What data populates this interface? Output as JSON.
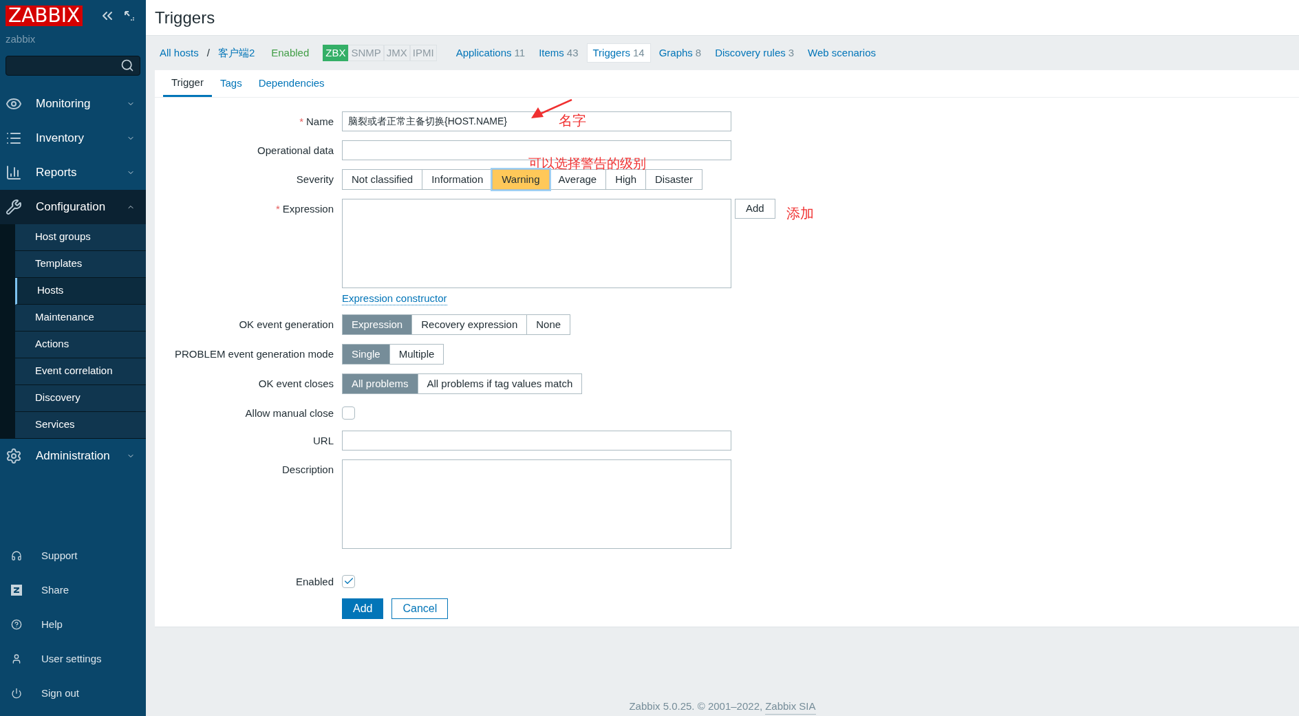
{
  "sidebar": {
    "logo": "ZABBIX",
    "server_name": "zabbix",
    "menu": [
      {
        "label": "Monitoring",
        "expanded": false
      },
      {
        "label": "Inventory",
        "expanded": false
      },
      {
        "label": "Reports",
        "expanded": false
      },
      {
        "label": "Configuration",
        "expanded": true,
        "children": [
          {
            "label": "Host groups",
            "selected": false
          },
          {
            "label": "Templates",
            "selected": false
          },
          {
            "label": "Hosts",
            "selected": true
          },
          {
            "label": "Maintenance",
            "selected": false
          },
          {
            "label": "Actions",
            "selected": false
          },
          {
            "label": "Event correlation",
            "selected": false
          },
          {
            "label": "Discovery",
            "selected": false
          },
          {
            "label": "Services",
            "selected": false
          }
        ]
      },
      {
        "label": "Administration",
        "expanded": false
      }
    ],
    "bottom_menu": [
      "Support",
      "Share",
      "Help",
      "User settings",
      "Sign out"
    ]
  },
  "page_title": "Triggers",
  "breadcrumbs": {
    "items": [
      "All hosts",
      "客户端2"
    ],
    "separator": "/"
  },
  "host_status": "Enabled",
  "availability": [
    {
      "label": "ZBX",
      "on": true
    },
    {
      "label": "SNMP",
      "on": false
    },
    {
      "label": "JMX",
      "on": false
    },
    {
      "label": "IPMI",
      "on": false
    }
  ],
  "host_tabs": [
    {
      "label": "Applications",
      "count": "11",
      "selected": false
    },
    {
      "label": "Items",
      "count": "43",
      "selected": false
    },
    {
      "label": "Triggers",
      "count": "14",
      "selected": true
    },
    {
      "label": "Graphs",
      "count": "8",
      "selected": false
    },
    {
      "label": "Discovery rules",
      "count": "3",
      "selected": false
    },
    {
      "label": "Web scenarios",
      "selected": false
    }
  ],
  "form_tabs": [
    {
      "label": "Trigger",
      "selected": true
    },
    {
      "label": "Tags",
      "selected": false
    },
    {
      "label": "Dependencies",
      "selected": false
    }
  ],
  "required_mark": "*",
  "form": [
    {
      "kind": "text",
      "label": "Name",
      "required": true,
      "value": "脑裂或者正常主备切换{HOST.NAME}"
    },
    {
      "kind": "text",
      "label": "Operational data",
      "required": false
    },
    {
      "kind": "severity",
      "label": "Severity",
      "required": false,
      "options": [
        {
          "label": "Not classified",
          "selected": false
        },
        {
          "label": "Information",
          "selected": false
        },
        {
          "label": "Warning",
          "selected": true
        },
        {
          "label": "Average",
          "selected": false
        },
        {
          "label": "High",
          "selected": false
        },
        {
          "label": "Disaster",
          "selected": false
        }
      ]
    },
    {
      "kind": "expression",
      "label": "Expression",
      "required": true,
      "button": "Add",
      "link": "Expression constructor"
    },
    {
      "kind": "segmented",
      "label": "OK event generation",
      "required": false,
      "options": [
        {
          "label": "Expression",
          "selected": true
        },
        {
          "label": "Recovery expression",
          "selected": false
        },
        {
          "label": "None",
          "selected": false
        }
      ]
    },
    {
      "kind": "segmented",
      "label": "PROBLEM event generation mode",
      "required": false,
      "options": [
        {
          "label": "Single",
          "selected": true
        },
        {
          "label": "Multiple",
          "selected": false
        }
      ]
    },
    {
      "kind": "segmented",
      "label": "OK event closes",
      "required": false,
      "options": [
        {
          "label": "All problems",
          "selected": true
        },
        {
          "label": "All problems if tag values match",
          "selected": false
        }
      ]
    },
    {
      "kind": "checkbox",
      "label": "Allow manual close",
      "required": false,
      "checked": false
    },
    {
      "kind": "text",
      "label": "URL",
      "required": false
    },
    {
      "kind": "textarea",
      "label": "Description",
      "required": false
    },
    {
      "kind": "checkbox",
      "label": "Enabled",
      "required": false,
      "checked": true
    }
  ],
  "buttons": [
    {
      "label": "Add",
      "primary": true
    },
    {
      "label": "Cancel",
      "primary": false
    }
  ],
  "annotations": [
    "名字",
    "可以选择警告的级别",
    "添加"
  ],
  "footer": {
    "text": "Zabbix 5.0.25. © 2001–2022,",
    "link": "Zabbix SIA"
  }
}
